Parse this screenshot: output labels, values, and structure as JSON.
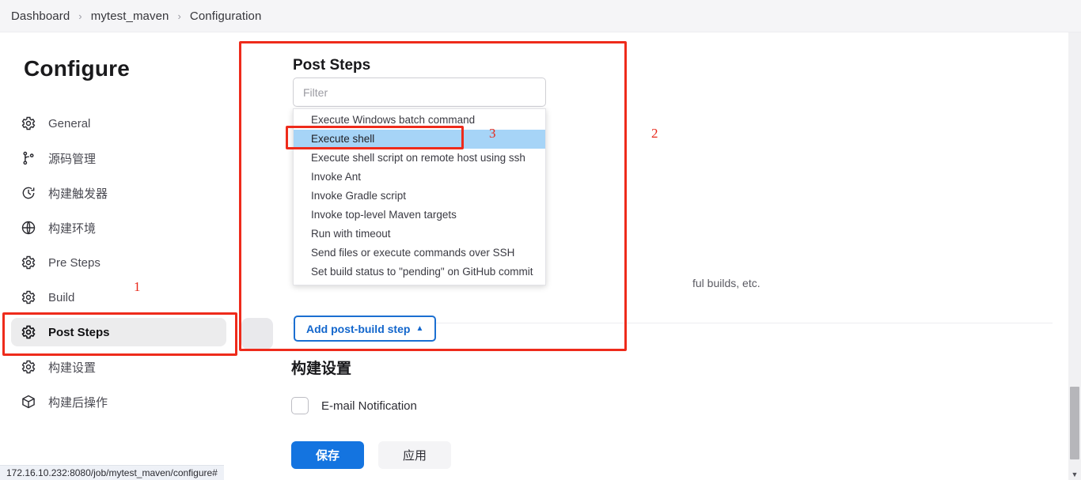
{
  "breadcrumb": {
    "items": [
      "Dashboard",
      "mytest_maven",
      "Configuration"
    ],
    "separator": "›"
  },
  "sidebar": {
    "title": "Configure",
    "items": [
      {
        "label": "General",
        "icon": "gear-icon",
        "active": false
      },
      {
        "label": "源码管理",
        "icon": "git-branch-icon",
        "active": false
      },
      {
        "label": "构建触发器",
        "icon": "clock-icon",
        "active": false
      },
      {
        "label": "构建环境",
        "icon": "globe-icon",
        "active": false
      },
      {
        "label": "Pre Steps",
        "icon": "gear-icon",
        "active": false
      },
      {
        "label": "Build",
        "icon": "gear-icon",
        "active": false
      },
      {
        "label": "Post Steps",
        "icon": "gear-icon",
        "active": true
      },
      {
        "label": "构建设置",
        "icon": "gear-icon",
        "active": false
      },
      {
        "label": "构建后操作",
        "icon": "package-icon",
        "active": false
      }
    ]
  },
  "main": {
    "post_steps_title": "Post Steps",
    "filter": {
      "value": "",
      "placeholder": "Filter"
    },
    "dropdown_options": [
      {
        "label": "Execute Windows batch command",
        "selected": false
      },
      {
        "label": "Execute shell",
        "selected": true
      },
      {
        "label": "Execute shell script on remote host using ssh",
        "selected": false
      },
      {
        "label": "Invoke Ant",
        "selected": false
      },
      {
        "label": "Invoke Gradle script",
        "selected": false
      },
      {
        "label": "Invoke top-level Maven targets",
        "selected": false
      },
      {
        "label": "Run with timeout",
        "selected": false
      },
      {
        "label": "Send files or execute commands over SSH",
        "selected": false
      },
      {
        "label": "Set build status to \"pending\" on GitHub commit",
        "selected": false
      }
    ],
    "add_post_build_step": {
      "label": "Add post-build step",
      "caret": "▲"
    },
    "help_text": "ful builds, etc.",
    "build_settings_title": "构建设置",
    "email_notification": {
      "label": "E-mail Notification",
      "checked": false
    },
    "save_button": "保存",
    "apply_button": "应用"
  },
  "annotations": [
    {
      "num": "1"
    },
    {
      "num": "2"
    },
    {
      "num": "3"
    }
  ],
  "statusbar": {
    "url": "172.16.10.232:8080/job/mytest_maven/configure#"
  },
  "colors": {
    "accent_blue": "#1474e0",
    "annotation_red": "#ee2b1b",
    "selected_option": "#a6d4f7",
    "sidebar_active": "#ececed"
  }
}
